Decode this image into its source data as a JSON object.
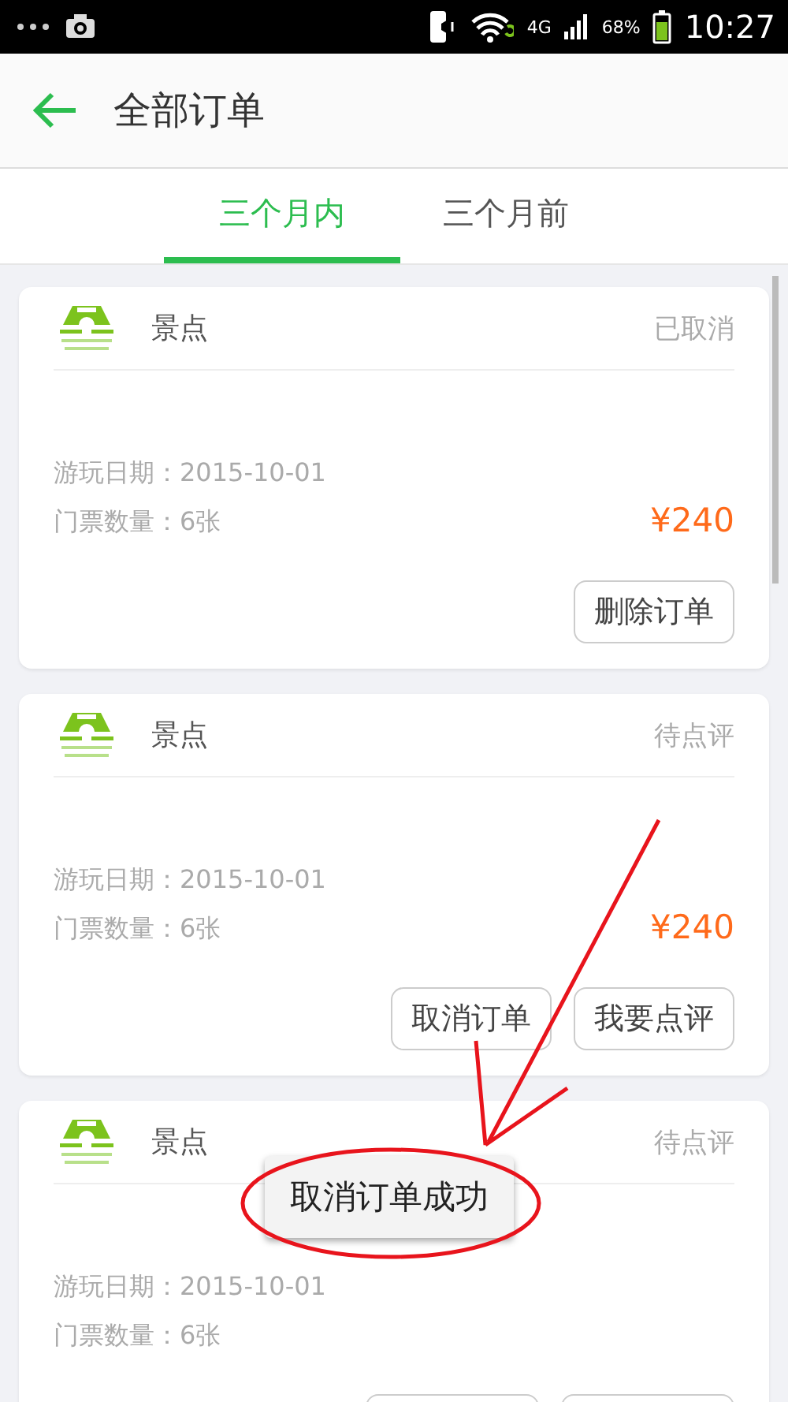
{
  "status_bar": {
    "network": "4G",
    "battery": "68%",
    "time": "10:27"
  },
  "header": {
    "title": "全部订单"
  },
  "tabs": [
    {
      "label": "三个月内",
      "selected": true
    },
    {
      "label": "三个月前",
      "selected": false
    }
  ],
  "orders": [
    {
      "category": "景点",
      "status": "已取消",
      "date_label": "游玩日期：",
      "date": "2015-10-01",
      "qty_label": "门票数量：",
      "qty": "6张",
      "price": "¥240",
      "buttons": [
        "删除订单"
      ],
      "buttons_cut": false
    },
    {
      "category": "景点",
      "status": "待点评",
      "date_label": "游玩日期：",
      "date": "2015-10-01",
      "qty_label": "门票数量：",
      "qty": "6张",
      "price": "¥240",
      "buttons": [
        "取消订单",
        "我要点评"
      ],
      "buttons_cut": false
    },
    {
      "category": "景点",
      "status": "待点评",
      "date_label": "游玩日期：",
      "date": "2015-10-01",
      "qty_label": "门票数量：",
      "qty": "6张",
      "buttons_cut": true
    }
  ],
  "toast": {
    "text": "取消订单成功"
  }
}
